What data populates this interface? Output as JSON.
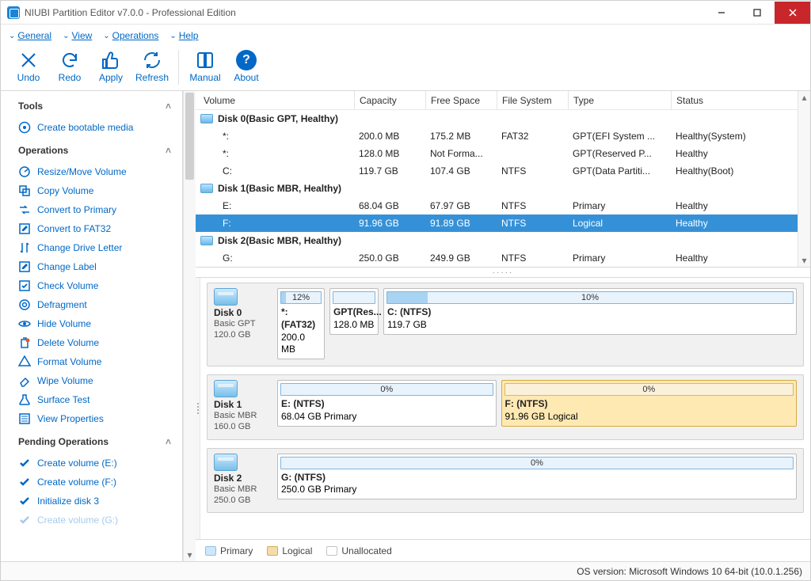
{
  "window": {
    "title": "NIUBI Partition Editor v7.0.0 - Professional Edition"
  },
  "menu": {
    "general": "General",
    "view": "View",
    "operations": "Operations",
    "help": "Help"
  },
  "toolbar": {
    "undo": "Undo",
    "redo": "Redo",
    "apply": "Apply",
    "refresh": "Refresh",
    "manual": "Manual",
    "about": "About"
  },
  "sidebar": {
    "tools_header": "Tools",
    "tools": {
      "bootable": "Create bootable media"
    },
    "ops_header": "Operations",
    "ops": {
      "resize": "Resize/Move Volume",
      "copy": "Copy Volume",
      "to_primary": "Convert to Primary",
      "to_fat32": "Convert to FAT32",
      "drive_letter": "Change Drive Letter",
      "change_label": "Change Label",
      "check": "Check Volume",
      "defrag": "Defragment",
      "hide": "Hide Volume",
      "delete": "Delete Volume",
      "format": "Format Volume",
      "wipe": "Wipe Volume",
      "surface": "Surface Test",
      "props": "View Properties"
    },
    "pending_header": "Pending Operations",
    "pending": {
      "p1": "Create volume (E:)",
      "p2": "Create volume (F:)",
      "p3": "Initialize disk 3",
      "p4": "Create volume (G:)"
    }
  },
  "columns": {
    "volume": "Volume",
    "capacity": "Capacity",
    "free": "Free Space",
    "fs": "File System",
    "type": "Type",
    "status": "Status"
  },
  "disks": {
    "d0": {
      "header": "Disk 0(Basic GPT, Healthy)",
      "r0": {
        "vol": "*:",
        "cap": "200.0 MB",
        "free": "175.2 MB",
        "fs": "FAT32",
        "type": "GPT(EFI System ...",
        "status": "Healthy(System)"
      },
      "r1": {
        "vol": "*:",
        "cap": "128.0 MB",
        "free": "Not Forma...",
        "fs": "",
        "type": "GPT(Reserved P...",
        "status": "Healthy"
      },
      "r2": {
        "vol": "C:",
        "cap": "119.7 GB",
        "free": "107.4 GB",
        "fs": "NTFS",
        "type": "GPT(Data Partiti...",
        "status": "Healthy(Boot)"
      }
    },
    "d1": {
      "header": "Disk 1(Basic MBR, Healthy)",
      "r0": {
        "vol": "E:",
        "cap": "68.04 GB",
        "free": "67.97 GB",
        "fs": "NTFS",
        "type": "Primary",
        "status": "Healthy"
      },
      "r1": {
        "vol": "F:",
        "cap": "91.96 GB",
        "free": "91.89 GB",
        "fs": "NTFS",
        "type": "Logical",
        "status": "Healthy"
      }
    },
    "d2": {
      "header": "Disk 2(Basic MBR, Healthy)",
      "r0": {
        "vol": "G:",
        "cap": "250.0 GB",
        "free": "249.9 GB",
        "fs": "NTFS",
        "type": "Primary",
        "status": "Healthy"
      }
    }
  },
  "maps": {
    "d0": {
      "name": "Disk 0",
      "sub1": "Basic GPT",
      "sub2": "120.0 GB",
      "p0": {
        "pct": "12%",
        "title": "*: (FAT32)",
        "sub": "200.0 MB"
      },
      "p1": {
        "title": "GPT(Res...",
        "sub": "128.0 MB"
      },
      "p2": {
        "pct": "10%",
        "title": "C: (NTFS)",
        "sub": "119.7 GB"
      }
    },
    "d1": {
      "name": "Disk 1",
      "sub1": "Basic MBR",
      "sub2": "160.0 GB",
      "p0": {
        "pct": "0%",
        "title": "E: (NTFS)",
        "sub": "68.04 GB Primary"
      },
      "p1": {
        "pct": "0%",
        "title": "F: (NTFS)",
        "sub": "91.96 GB Logical"
      }
    },
    "d2": {
      "name": "Disk 2",
      "sub1": "Basic MBR",
      "sub2": "250.0 GB",
      "p0": {
        "pct": "0%",
        "title": "G: (NTFS)",
        "sub": "250.0 GB Primary"
      }
    }
  },
  "legend": {
    "primary": "Primary",
    "logical": "Logical",
    "unallocated": "Unallocated"
  },
  "status": "OS version: Microsoft Windows 10  64-bit  (10.0.1.256)"
}
